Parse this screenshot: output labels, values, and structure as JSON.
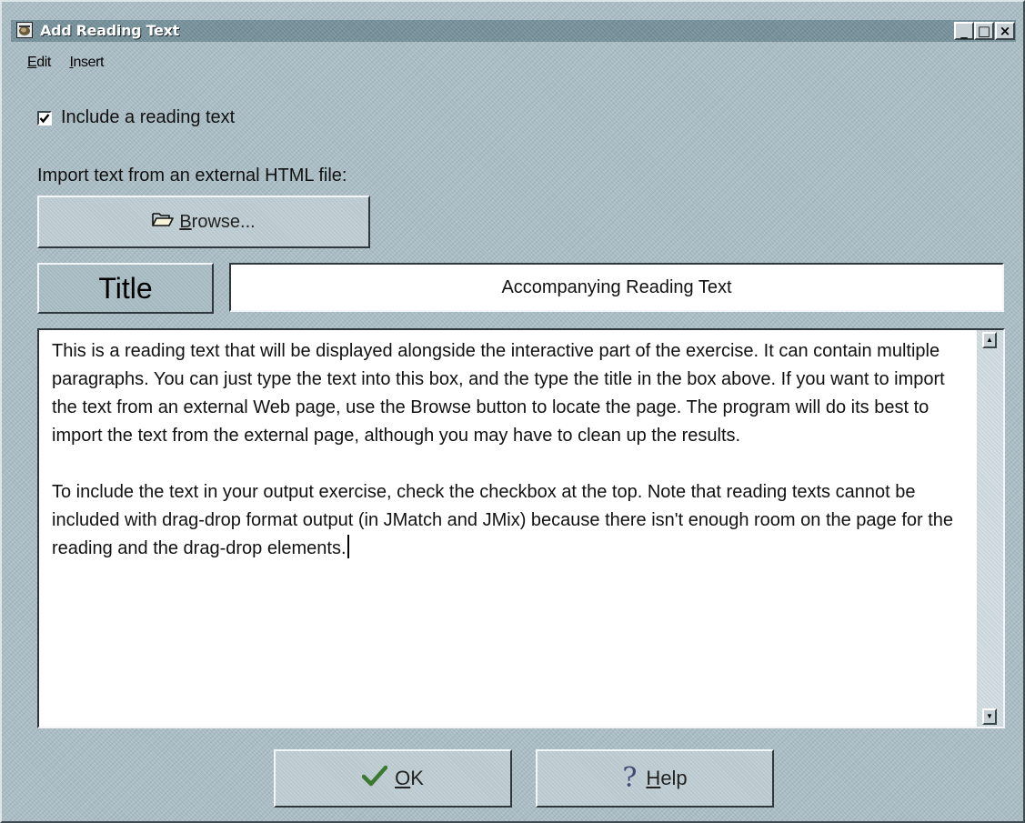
{
  "window": {
    "title": "Add Reading Text",
    "controls": {
      "minimize": "_",
      "maximize": "□",
      "close": "×"
    }
  },
  "menu": {
    "items": [
      {
        "mnemonic": "E",
        "rest": "dit"
      },
      {
        "mnemonic": "I",
        "rest": "nsert"
      }
    ]
  },
  "include_checkbox": {
    "label": "Include a reading text",
    "checked": true
  },
  "import": {
    "label": "Import text from an external HTML file:",
    "browse_button": {
      "mnemonic": "B",
      "rest": "rowse...",
      "icon": "folder-open-icon"
    }
  },
  "title_field": {
    "label": "Title",
    "value": "Accompanying Reading Text"
  },
  "reading_text": {
    "paragraphs": [
      "This is a reading text that will be displayed alongside the interactive part of the exercise. It can contain multiple paragraphs. You can just type the text into this box, and the type the title in the box above. If you want to import the text from an external Web page, use the Browse button to locate the page. The program will do its best to import the text from the external page, although you may have to clean up the results.",
      "To include the text in your output exercise, check the checkbox at the top. Note that reading texts cannot be included with drag-drop format output (in JMatch and JMix) because there isn't enough room on the page for the reading and the drag-drop elements."
    ]
  },
  "buttons": {
    "ok": {
      "mnemonic": "O",
      "rest": "K",
      "icon": "checkmark-icon",
      "icon_color": "#3b7a2e"
    },
    "help": {
      "mnemonic": "H",
      "rest": "elp",
      "icon": "question-mark-icon",
      "icon_glyph": "?"
    }
  },
  "colors": {
    "background": "#a9bcc4",
    "titlebar": "#76909a",
    "text_area": "#ffffff"
  }
}
